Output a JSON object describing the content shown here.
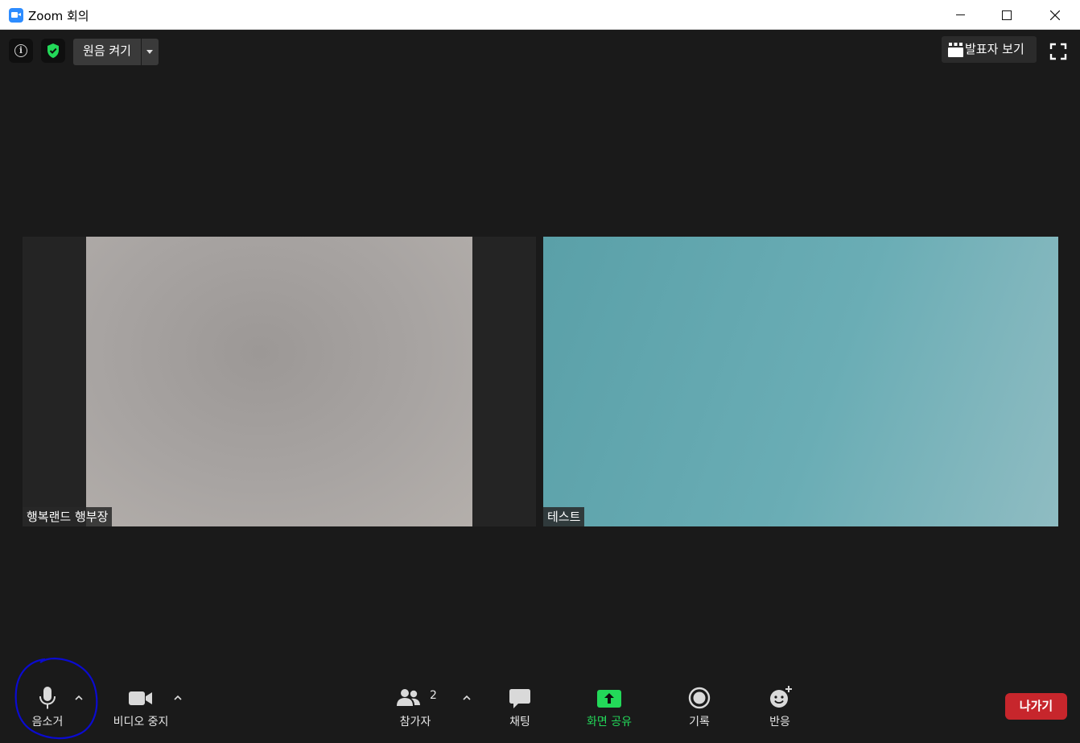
{
  "window": {
    "title": "Zoom 회의"
  },
  "top_controls": {
    "original_sound_label": "원음 켜기",
    "speaker_view_label": "발표자 보기"
  },
  "participants": [
    {
      "name": "행복랜드 행부장"
    },
    {
      "name": "테스트"
    }
  ],
  "toolbar": {
    "mute_label": "음소거",
    "video_label": "비디오 중지",
    "participants_label": "참가자",
    "participants_count": "2",
    "chat_label": "채팅",
    "share_label": "화면 공유",
    "record_label": "기록",
    "reactions_label": "반응",
    "leave_label": "나가기"
  },
  "colors": {
    "background": "#1a1a1a",
    "share_accent": "#23d959",
    "leave_red": "#c7262c",
    "zoom_blue": "#2d8cff",
    "annotation_blue": "#0b0bd0"
  }
}
